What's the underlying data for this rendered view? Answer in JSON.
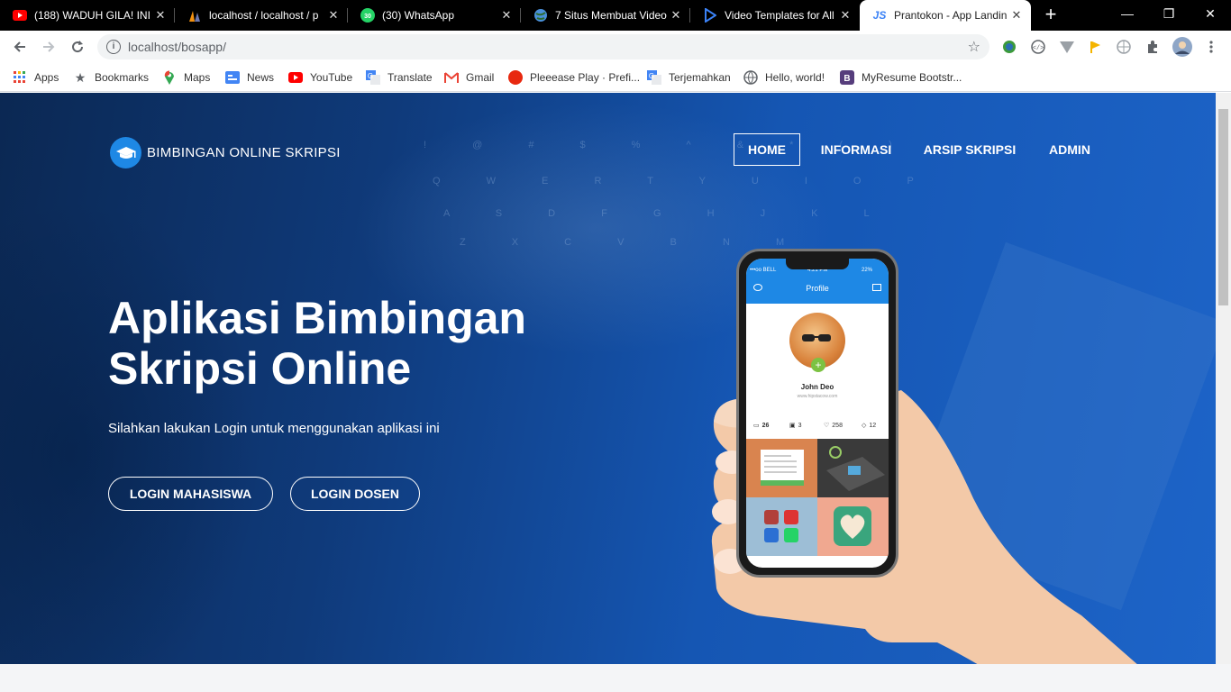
{
  "browser": {
    "tabs": [
      {
        "title": "(188) WADUH GILA! INI",
        "icon": "youtube-icon",
        "color": "#ff0000"
      },
      {
        "title": "localhost / localhost / p",
        "icon": "phpmyadmin-icon",
        "color": "#f29111"
      },
      {
        "title": "(30) WhatsApp",
        "icon": "whatsapp-icon",
        "color": "#25d366",
        "badge": "30"
      },
      {
        "title": "7 Situs Membuat Video",
        "icon": "globe-icon",
        "color": "#4a90d9"
      },
      {
        "title": "Video Templates for All",
        "icon": "play-icon",
        "color": "#3b82f6"
      },
      {
        "title": "Prantokon - App Landin",
        "icon": "js-icon",
        "color": "#3b82f6",
        "active": true
      }
    ],
    "new_tab_label": "+",
    "window_controls": {
      "minimize": "—",
      "restore": "❐",
      "close": "✕"
    },
    "url": "localhost/bosapp/",
    "bookmarks": [
      {
        "label": "Apps",
        "icon": "apps-grid-icon"
      },
      {
        "label": "Bookmarks",
        "icon": "star-icon"
      },
      {
        "label": "Maps",
        "icon": "maps-pin-icon"
      },
      {
        "label": "News",
        "icon": "google-news-icon"
      },
      {
        "label": "YouTube",
        "icon": "youtube-icon"
      },
      {
        "label": "Translate",
        "icon": "translate-icon"
      },
      {
        "label": "Gmail",
        "icon": "gmail-icon"
      },
      {
        "label": "Pleeease Play · Prefi...",
        "icon": "red-circle-icon"
      },
      {
        "label": "Terjemahkan",
        "icon": "translate-icon"
      },
      {
        "label": "Hello, world!",
        "icon": "globe-icon"
      },
      {
        "label": "MyResume Bootstr...",
        "icon": "bootstrap-icon"
      }
    ]
  },
  "site": {
    "logo_text": "BIMBINGAN ONLINE SKRIPSI",
    "nav": [
      {
        "label": "HOME",
        "active": true
      },
      {
        "label": "INFORMASI"
      },
      {
        "label": "ARSIP SKRIPSI"
      },
      {
        "label": "ADMIN"
      }
    ],
    "hero": {
      "title_line1": "Aplikasi Bimbingan",
      "title_line2": "Skripsi Online",
      "subtitle": "Silahkan lakukan Login untuk menggunakan aplikasi ini",
      "btn_mahasiswa": "LOGIN MAHASISWA",
      "btn_dosen": "LOGIN DOSEN"
    },
    "phone": {
      "carrier": "•••oo BELL",
      "time": "4:21 PM",
      "battery": "22%",
      "screen_title": "Profile",
      "name": "John Deo",
      "url": "www.hipstacow.com",
      "stats": [
        {
          "icon": "image-icon",
          "value": "26"
        },
        {
          "icon": "briefcase-icon",
          "value": "3"
        },
        {
          "icon": "heart-icon",
          "value": "258"
        },
        {
          "icon": "tag-icon",
          "value": "12"
        }
      ]
    }
  }
}
